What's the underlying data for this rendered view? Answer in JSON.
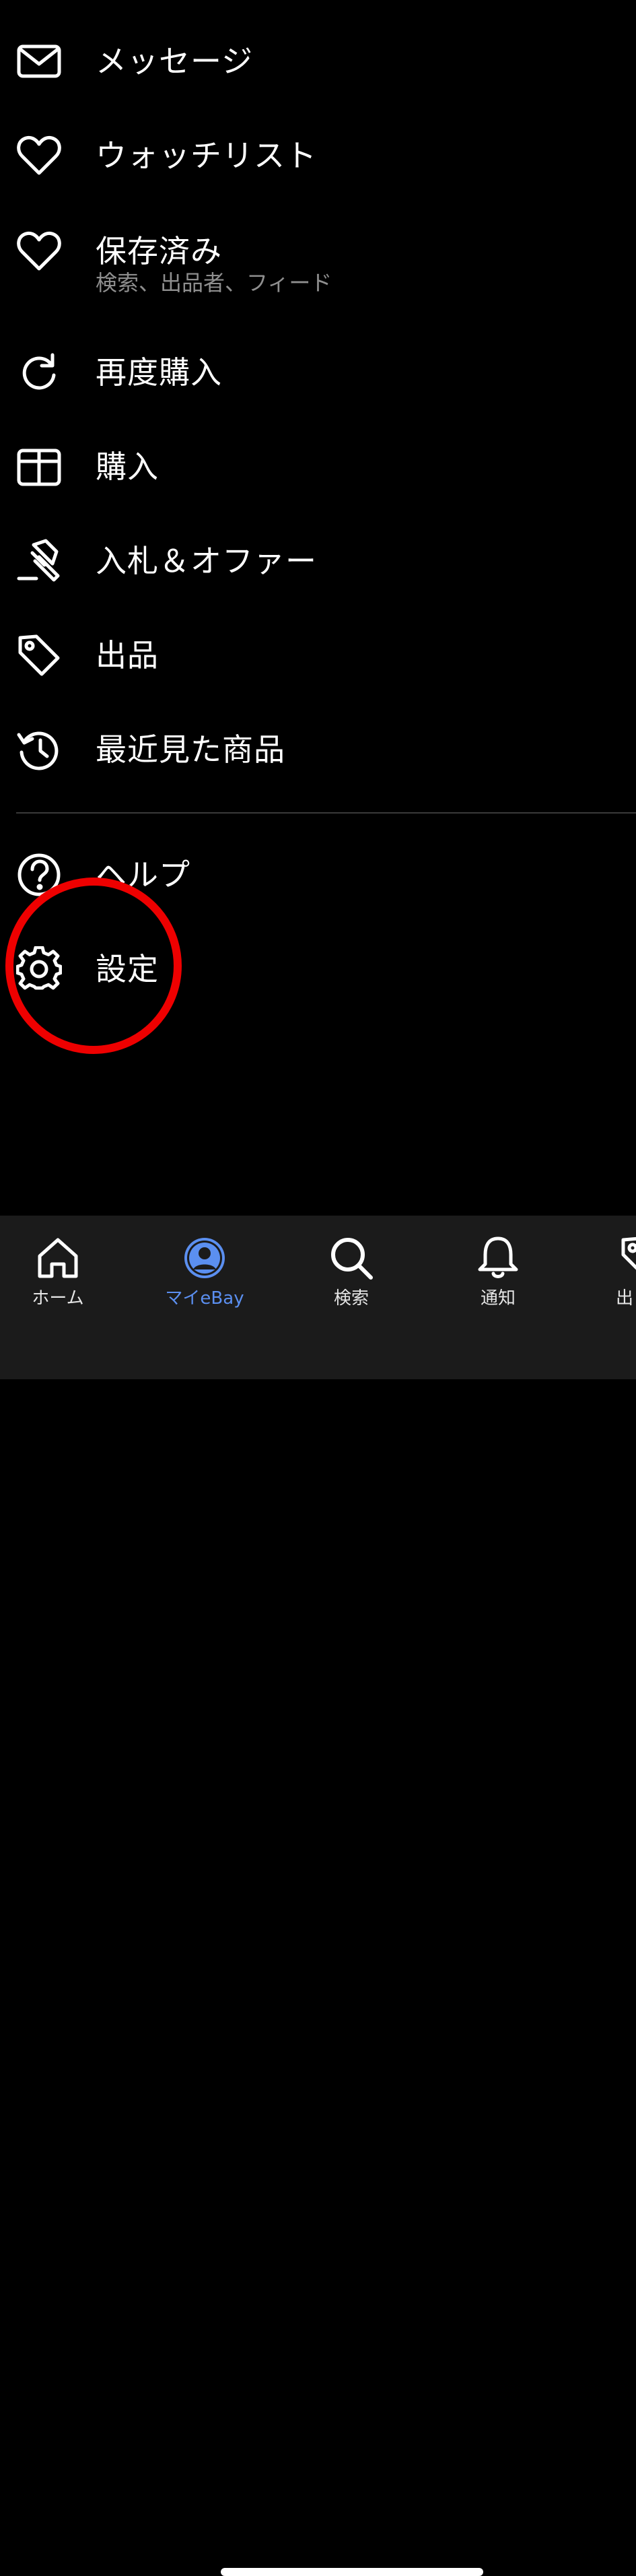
{
  "menu": {
    "items": [
      {
        "label": "メッセージ",
        "icon": "mail-icon"
      },
      {
        "label": "ウォッチリスト",
        "icon": "heart-icon"
      },
      {
        "label": "保存済み",
        "sublabel": "検索、出品者、フィード",
        "icon": "heart-icon"
      },
      {
        "label": "再度購入",
        "icon": "refresh-icon"
      },
      {
        "label": "購入",
        "icon": "box-icon"
      },
      {
        "label": "入札＆オファー",
        "icon": "gavel-icon"
      },
      {
        "label": "出品",
        "icon": "tag-icon"
      },
      {
        "label": "最近見た商品",
        "icon": "history-icon"
      },
      {
        "label": "ヘルプ",
        "icon": "help-icon"
      },
      {
        "label": "設定",
        "icon": "gear-icon"
      }
    ]
  },
  "tabbar": {
    "tabs": [
      {
        "label": "ホーム",
        "icon": "home-icon",
        "active": false
      },
      {
        "label": "マイeBay",
        "icon": "account-icon",
        "active": true
      },
      {
        "label": "検索",
        "icon": "search-icon",
        "active": false
      },
      {
        "label": "通知",
        "icon": "bell-icon",
        "active": false
      },
      {
        "label": "出",
        "icon": "tag-icon",
        "active": false
      }
    ]
  },
  "colors": {
    "background": "#000000",
    "text": "#ffffff",
    "sublabel": "#8e8e8e",
    "accent": "#5b8ff0",
    "highlight": "#ee0000",
    "tabbar_bg": "#1b1b1b"
  }
}
